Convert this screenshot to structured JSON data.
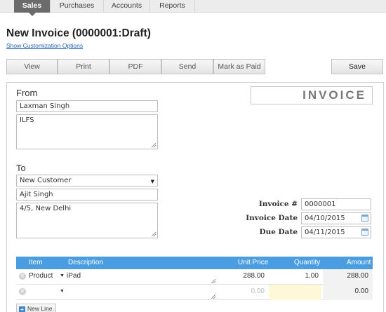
{
  "nav": {
    "tabs": [
      "Sales",
      "Purchases",
      "Accounts",
      "Reports"
    ],
    "active": "Sales"
  },
  "page": {
    "title": "New Invoice (0000001:Draft)",
    "customization_link": "Show Customization Options"
  },
  "toolbar": {
    "view": "View",
    "print": "Print",
    "pdf": "PDF",
    "send": "Send",
    "mark_paid": "Mark as Paid",
    "save": "Save"
  },
  "from": {
    "label": "From",
    "name": "Laxman Singh",
    "address": "ILFS"
  },
  "to": {
    "label": "To",
    "customer_select": "New Customer",
    "name": "Ajit Singh",
    "address": "4/5, New Delhi"
  },
  "invoice": {
    "heading": "INVOICE",
    "number_label": "Invoice #",
    "number": "0000001",
    "date_label": "Invoice Date",
    "date": "04/10/2015",
    "due_label": "Due Date",
    "due_date": "04/11/2015"
  },
  "items": {
    "headers": {
      "item": "Item",
      "description": "Description",
      "unit_price": "Unit Price",
      "quantity": "Quantity",
      "amount": "Amount"
    },
    "rows": [
      {
        "item": "Product",
        "description": "iPad",
        "unit_price": "288.00",
        "quantity": "1.00",
        "amount": "288.00"
      },
      {
        "item": "",
        "description": "",
        "unit_price": "0.00",
        "quantity": "",
        "amount": "0.00"
      }
    ],
    "new_line": "New Line"
  },
  "colors": {
    "accent": "#4a9de0",
    "nav_active": "#6b6b6b",
    "link": "#2266bb"
  }
}
